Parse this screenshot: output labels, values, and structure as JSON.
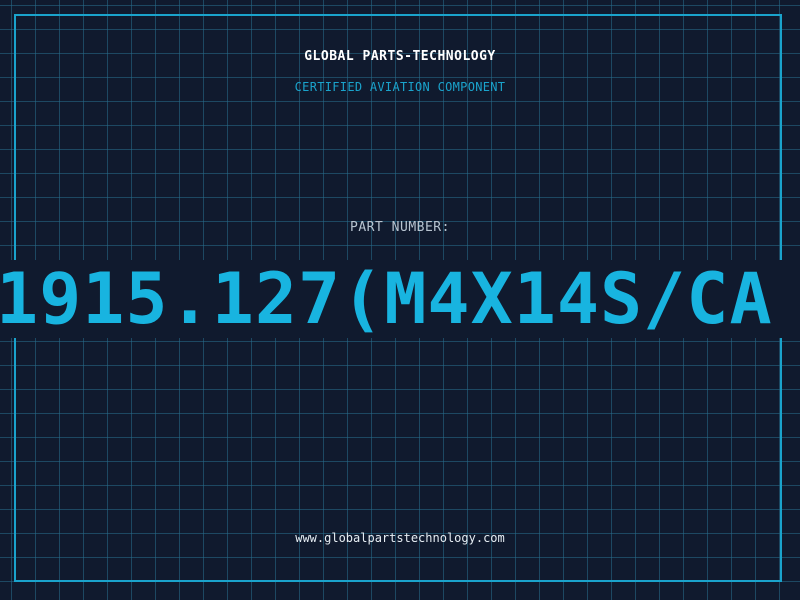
{
  "header": {
    "company": "GLOBAL PARTS-TECHNOLOGY",
    "tagline": "CERTIFIED AVIATION COMPONENT"
  },
  "part": {
    "label": "PART NUMBER:",
    "number": "1915.127(M4X14S/CA"
  },
  "footer": {
    "website": "www.globalpartstechnology.com"
  },
  "colors": {
    "background": "#101a2e",
    "accent": "#1aa3cc",
    "part_number": "#18b4e0"
  }
}
